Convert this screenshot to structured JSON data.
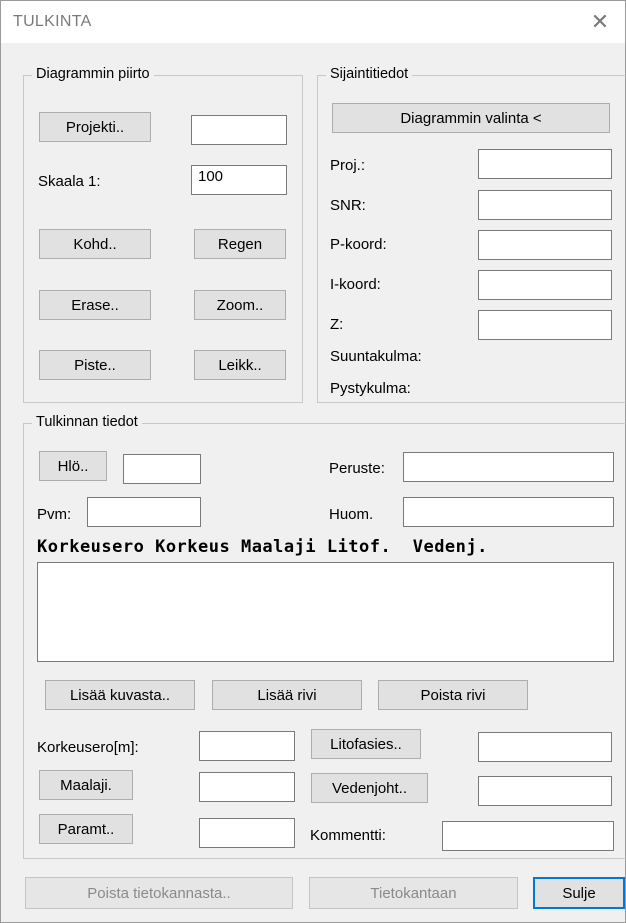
{
  "window": {
    "title": "TULKINTA",
    "close_glyph": "✕"
  },
  "drawing": {
    "legend": "Diagrammin piirto",
    "project_button": "Projekti..",
    "project_value": "",
    "scale_label": "Skaala 1:",
    "scale_value": "100",
    "kohd_button": "Kohd..",
    "regen_button": "Regen",
    "erase_button": "Erase..",
    "zoom_button": "Zoom..",
    "piste_button": "Piste..",
    "leikk_button": "Leikk.."
  },
  "location": {
    "legend": "Sijaintitiedot",
    "select_button": "Diagrammin valinta <",
    "proj_label": "Proj.:",
    "snr_label": "SNR:",
    "pkoord_label": "P-koord:",
    "ikoord_label": "I-koord:",
    "z_label": "Z:",
    "suuntakulma_label": "Suuntakulma:",
    "pystykulma_label": "Pystykulma:"
  },
  "interpretation": {
    "legend": "Tulkinnan tiedot",
    "hlo_button": "Hlö..",
    "hlo_value": "",
    "peruste_label": "Peruste:",
    "peruste_value": "",
    "pvm_label": "Pvm:",
    "pvm_value": "",
    "huom_label": "Huom.",
    "huom_value": "",
    "columns_header": "Korkeusero Korkeus Maalaji Litof.  Vedenj.",
    "add_from_image_button": "Lisää kuvasta..",
    "add_row_button": "Lisää rivi",
    "delete_row_button": "Poista rivi",
    "korkeusero_label": "Korkeusero[m]:",
    "litofasies_button": "Litofasies..",
    "maalaji_button": "Maalaji.",
    "vedenjoht_button": "Vedenjoht..",
    "paramt_button": "Paramt..",
    "kommentti_label": "Kommentti:"
  },
  "footer": {
    "delete_db_button": "Poista tietokannasta..",
    "to_db_button": "Tietokantaan",
    "close_button": "Sulje"
  }
}
